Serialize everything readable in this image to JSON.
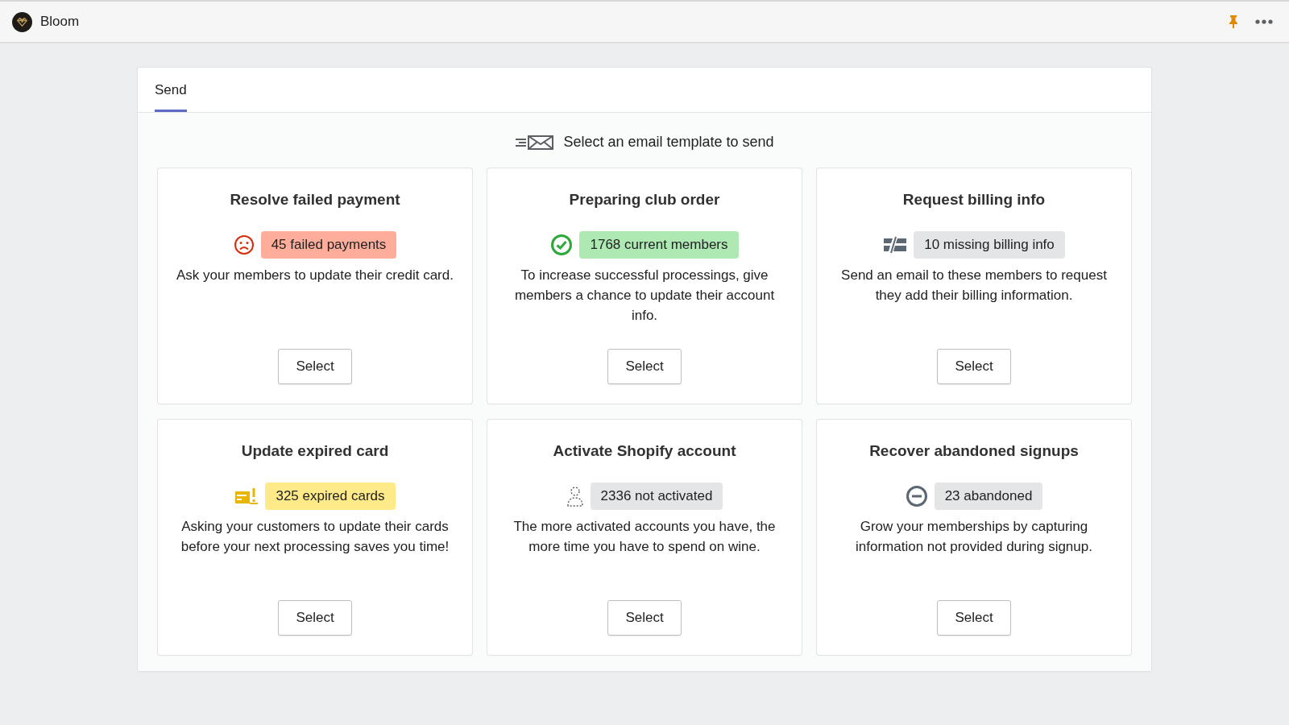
{
  "app": {
    "name": "Bloom"
  },
  "tabs": [
    {
      "label": "Send",
      "selected": true
    }
  ],
  "heading": "Select an email template to send",
  "templates": [
    {
      "title": "Resolve failed payment",
      "kind": "failed",
      "badge": "45 failed payments",
      "color": "#fead9a",
      "description": "Ask your members to update their credit card.",
      "button": "Select"
    },
    {
      "title": "Preparing club order",
      "kind": "current",
      "badge": "1768 current members",
      "color": "#aee9b3",
      "description": "To increase successful processings, give members a chance to update their account info.",
      "button": "Select"
    },
    {
      "title": "Request billing info",
      "kind": "billing",
      "badge": "10 missing billing info",
      "color": "#e4e5e7",
      "description": "Send an email to these members to request they add their billing information.",
      "button": "Select"
    },
    {
      "title": "Update expired card",
      "kind": "expired",
      "badge": "325 expired cards",
      "color": "#ffea8a",
      "description": "Asking your customers to update their cards before your next processing saves you time!",
      "button": "Select"
    },
    {
      "title": "Activate Shopify account",
      "kind": "inactive",
      "badge": "2336 not activated",
      "color": "#e4e5e7",
      "description": "The more activated accounts you have, the more time you have to spend on wine.",
      "button": "Select"
    },
    {
      "title": "Recover abandoned signups",
      "kind": "abandoned",
      "badge": "23 abandoned",
      "color": "#e4e5e7",
      "description": "Grow your memberships by capturing information not provided during signup.",
      "button": "Select"
    }
  ]
}
